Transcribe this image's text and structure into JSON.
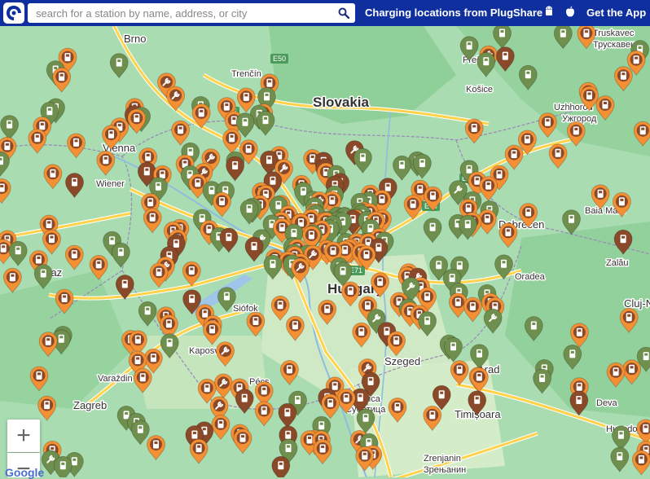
{
  "header": {
    "search_placeholder": "search for a station by name, address, or city",
    "title": "Charging locations from PlugShare",
    "get_app_label": "Get the App"
  },
  "icons": {
    "logo": "plugshare-logo-icon",
    "search": "search-icon",
    "android": "android-icon",
    "apple": "apple-icon",
    "station": "charging-station-icon",
    "wrench": "wrench-icon"
  },
  "zoom": {
    "in_label": "+",
    "out_label": "−"
  },
  "attribution": "Google",
  "colors": {
    "topbar": "#0f2f9e",
    "pin_orange": "#f49033",
    "pin_green": "#6e8f4d",
    "pin_brown": "#8a4a2a",
    "land": "#a8dcb0",
    "highway": "#ffd24a"
  },
  "map": {
    "cities": [
      {
        "name": "Brno",
        "size": "md"
      },
      {
        "name": "Trenčín",
        "size": "sm"
      },
      {
        "name": "Prešov",
        "size": "sm"
      },
      {
        "name": "Truskavec",
        "size": "sm"
      },
      {
        "name": "Трускавець",
        "size": "sm"
      },
      {
        "name": "Slovakia",
        "size": "lg"
      },
      {
        "name": "Košice",
        "size": "sm"
      },
      {
        "name": "Uzhhorod",
        "size": "sm"
      },
      {
        "name": "Ужгород",
        "size": "sm"
      },
      {
        "name": "Vienna",
        "size": "md"
      },
      {
        "name": "Wiener",
        "size": "sm"
      },
      {
        "name": "Debrecen",
        "size": "md"
      },
      {
        "name": "Baia Mare",
        "size": "sm"
      },
      {
        "name": "Graz",
        "size": "md"
      },
      {
        "name": "Oradea",
        "size": "sm"
      },
      {
        "name": "Zalău",
        "size": "sm"
      },
      {
        "name": "Hungary",
        "size": "lg"
      },
      {
        "name": "Siófok",
        "size": "sm"
      },
      {
        "name": "Cluj-Napoca",
        "size": "md"
      },
      {
        "name": "Kaposvár",
        "size": "sm"
      },
      {
        "name": "Szeged",
        "size": "md"
      },
      {
        "name": "Varaždin",
        "size": "sm"
      },
      {
        "name": "Arad",
        "size": "md"
      },
      {
        "name": "Pécs",
        "size": "sm"
      },
      {
        "name": "Subotica",
        "size": "sm"
      },
      {
        "name": "Суботица",
        "size": "sm"
      },
      {
        "name": "Zagreb",
        "size": "md"
      },
      {
        "name": "Timișoara",
        "size": "md"
      },
      {
        "name": "Deva",
        "size": "sm"
      },
      {
        "name": "Hunedoara",
        "size": "sm"
      },
      {
        "name": "Zrenjanin",
        "size": "sm"
      },
      {
        "name": "Зрењанин",
        "size": "sm"
      }
    ],
    "road_labels": [
      "E50",
      "E75",
      "E79",
      "E71",
      "E79"
    ]
  }
}
